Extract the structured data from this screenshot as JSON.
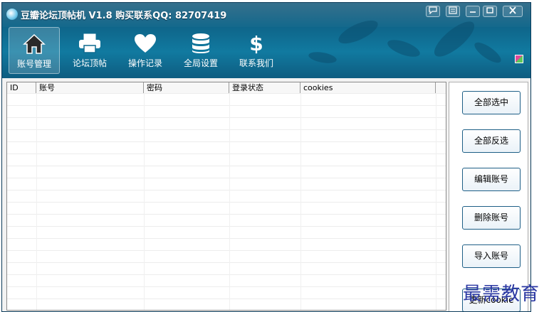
{
  "window": {
    "title": "豆瓣论坛顶帖机 V1.8 购买联系QQ: 82707419",
    "controls": [
      "chat-icon",
      "menu-icon",
      "minimize-icon",
      "maximize-icon",
      "close-icon"
    ]
  },
  "nav": {
    "items": [
      {
        "label": "账号管理",
        "icon": "home-icon",
        "active": true
      },
      {
        "label": "论坛顶帖",
        "icon": "printer-icon",
        "active": false
      },
      {
        "label": "操作记录",
        "icon": "heart-icon",
        "active": false
      },
      {
        "label": "全局设置",
        "icon": "database-icon",
        "active": false
      },
      {
        "label": "联系我们",
        "icon": "dollar-icon",
        "active": false
      }
    ]
  },
  "table": {
    "columns": [
      "ID",
      "账号",
      "密码",
      "登录状态",
      "cookies"
    ],
    "rows": []
  },
  "actions": {
    "buttons": [
      "全部选中",
      "全部反选",
      "编辑账号",
      "删除账号",
      "导入账号",
      "更新cookie"
    ]
  },
  "watermark": "最需教育",
  "colors": {
    "header": "#0f6a8f",
    "button_border": "#1e5f86",
    "watermark": "#2c39a3"
  }
}
